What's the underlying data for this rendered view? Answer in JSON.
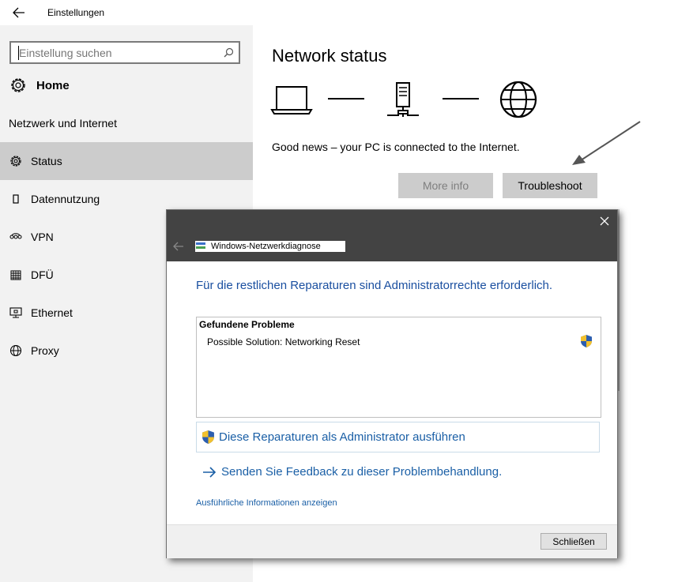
{
  "titlebar": {
    "app_title": "Einstellungen",
    "back_icon": "arrow-left-icon"
  },
  "sidebar": {
    "search_placeholder": "Einstellung suchen",
    "home_label": "Home",
    "section_title": "Netzwerk und Internet",
    "items": [
      {
        "label": "Status",
        "icon": "gear-icon",
        "selected": true
      },
      {
        "label": "Datennutzung",
        "icon": "data-usage-icon"
      },
      {
        "label": "VPN",
        "icon": "vpn-icon"
      },
      {
        "label": "DFÜ",
        "icon": "dialup-icon"
      },
      {
        "label": "Ethernet",
        "icon": "ethernet-icon"
      },
      {
        "label": "Proxy",
        "icon": "globe-icon"
      }
    ]
  },
  "main": {
    "title": "Network status",
    "status_message": "Good news – your PC is connected to the Internet.",
    "more_info_label": "More info",
    "troubleshoot_label": "Troubleshoot"
  },
  "dialog": {
    "title": "Windows-Netzwerkdiagnose",
    "heading": "Für die restlichen Reparaturen sind Administratorrechte erforderlich.",
    "problems_title": "Gefundene Probleme",
    "problem_item": "Possible Solution: Networking Reset",
    "admin_action": "Diese Reparaturen als Administrator ausführen",
    "feedback_link": "Senden Sie Feedback zu dieser Problembehandlung.",
    "details_link": "Ausführliche Informationen anzeigen",
    "close_button": "Schließen"
  },
  "colors": {
    "link_blue": "#1a5fa6",
    "heading_blue": "#1a4fa0",
    "dialog_header": "#434343",
    "selected_nav": "#cccccc"
  }
}
